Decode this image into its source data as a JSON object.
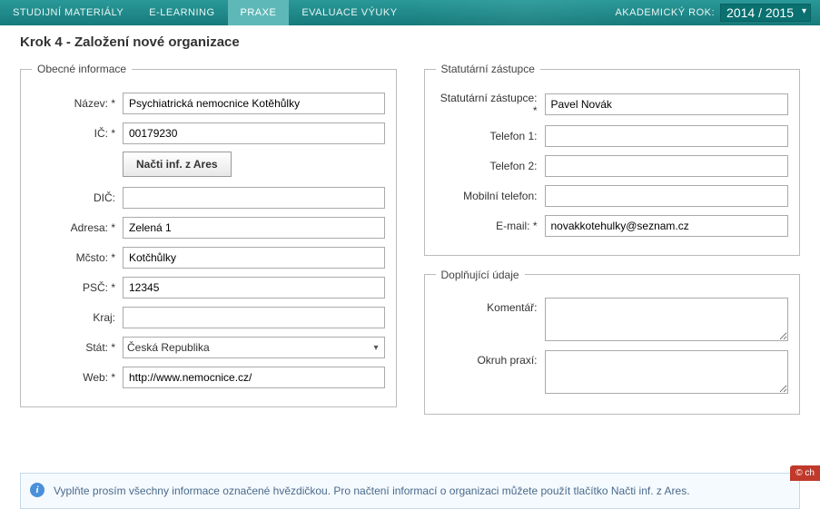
{
  "nav": {
    "items": [
      {
        "label": "STUDIJNÍ MATERIÁLY"
      },
      {
        "label": "E-LEARNING"
      },
      {
        "label": "PRAXE"
      },
      {
        "label": "EVALUACE VÝUKY"
      }
    ],
    "year_label": "AKADEMICKÝ ROK:",
    "year_value": "2014 / 2015"
  },
  "page": {
    "title": "Krok 4 - Založení nové organizace"
  },
  "general": {
    "legend": "Obecné informace",
    "nazev_label": "Název: *",
    "nazev_value": "Psychiatrická nemocnice Kotěhůlky",
    "ic_label": "IČ: *",
    "ic_value": "00179230",
    "ares_button": "Načti inf. z Ares",
    "dic_label": "DIČ:",
    "dic_value": "",
    "adresa_label": "Adresa: *",
    "adresa_value": "Zelená 1",
    "mesto_label": "Mčsto: *",
    "mesto_value": "Kotčhůlky",
    "psc_label": "PSČ: *",
    "psc_value": "12345",
    "kraj_label": "Kraj:",
    "kraj_value": "",
    "stat_label": "Stát: *",
    "stat_value": "Česká Republika",
    "web_label": "Web: *",
    "web_value": "http://www.nemocnice.cz/"
  },
  "statutory": {
    "legend": "Statutární zástupce",
    "zastupce_label": "Statutární zástupce: *",
    "zastupce_value": "Pavel Novák",
    "tel1_label": "Telefon 1:",
    "tel1_value": "",
    "tel2_label": "Telefon 2:",
    "tel2_value": "",
    "mobil_label": "Mobilní telefon:",
    "mobil_value": "",
    "email_label": "E-mail: *",
    "email_value": "novakkotehulky@seznam.cz"
  },
  "additional": {
    "legend": "Doplňující údaje",
    "komentar_label": "Komentář:",
    "komentar_value": "",
    "okruh_label": "Okruh praxí:",
    "okruh_value": ""
  },
  "alert": {
    "text": "Vyplňte prosím všechny informace označené hvězdičkou. Pro načtení informací o organizaci můžete použít tlačítko Načti inf. z Ares."
  },
  "chat": {
    "label": "© ch"
  }
}
